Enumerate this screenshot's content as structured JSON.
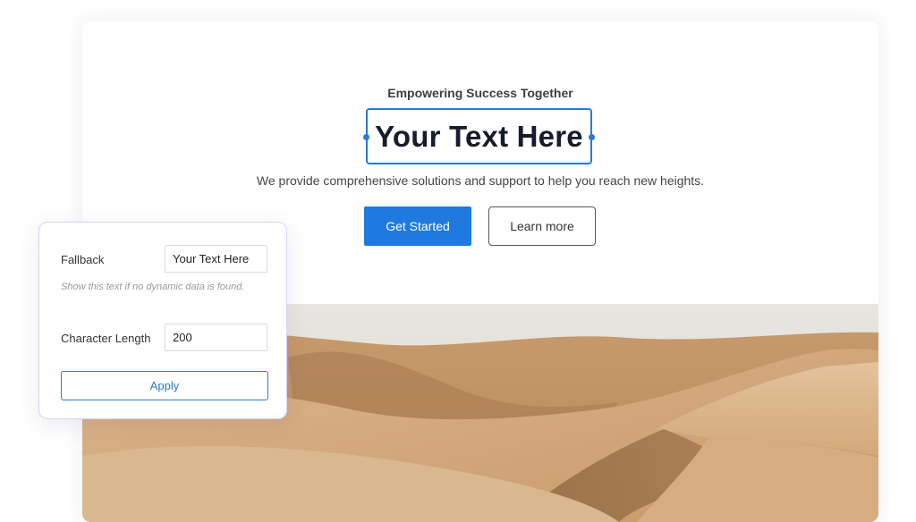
{
  "hero": {
    "eyebrow": "Empowering Success Together",
    "headline": "Your Text Here",
    "subtext": "We provide comprehensive solutions and support to help you reach new heights.",
    "primary_button": "Get Started",
    "secondary_button": "Learn more",
    "image_alt": "desert-sand-dunes"
  },
  "settings_panel": {
    "fallback_label": "Fallback",
    "fallback_value": "Your Text Here",
    "fallback_hint": "Show this text if no dynamic data is found.",
    "char_length_label": "Character Length",
    "char_length_value": "200",
    "apply_label": "Apply"
  },
  "colors": {
    "accent": "#1f7ae0",
    "selection": "#2a7ad1",
    "panel_border": "#d8d3f3",
    "headline": "#171c2b"
  }
}
